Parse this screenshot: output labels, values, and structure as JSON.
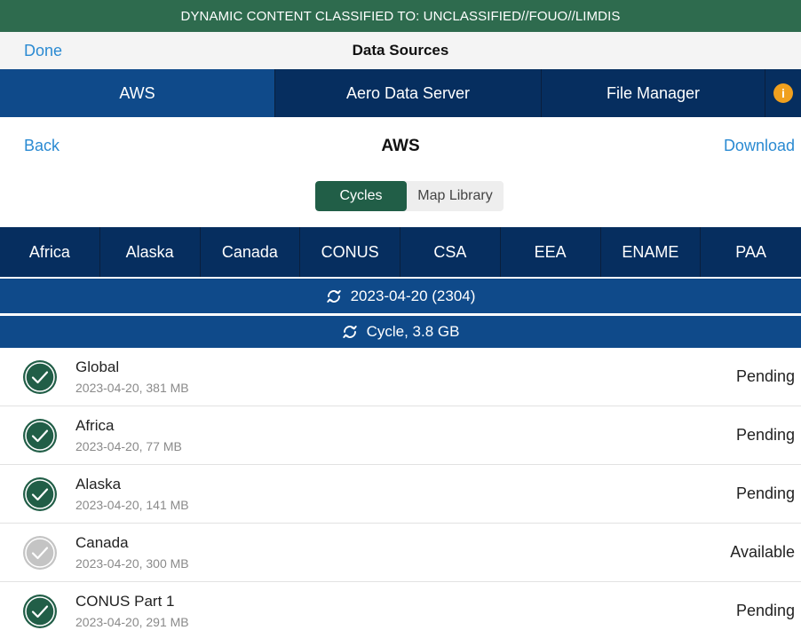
{
  "banner": {
    "text": "DYNAMIC CONTENT CLASSIFIED TO: UNCLASSIFIED//FOUO//LIMDIS"
  },
  "navbar": {
    "done_label": "Done",
    "title": "Data Sources"
  },
  "tabs": [
    {
      "label": "AWS",
      "active": true
    },
    {
      "label": "Aero Data Server",
      "active": false
    },
    {
      "label": "File Manager",
      "active": false
    }
  ],
  "info_icon_glyph": "i",
  "subheader": {
    "back_label": "Back",
    "title": "AWS",
    "download_label": "Download"
  },
  "segments": {
    "cycles_label": "Cycles",
    "map_library_label": "Map Library",
    "selected": "Cycles"
  },
  "regions": [
    "Africa",
    "Alaska",
    "Canada",
    "CONUS",
    "CSA",
    "EEA",
    "ENAME",
    "PAA"
  ],
  "cycle_bar": {
    "label": "2023-04-20 (2304)",
    "icon": "sync-icon"
  },
  "cycle_size_bar": {
    "label": "Cycle, 3.8 GB",
    "icon": "sync-icon"
  },
  "items": [
    {
      "name": "Global",
      "meta": "2023-04-20, 381 MB",
      "status": "Pending",
      "checked": true
    },
    {
      "name": "Africa",
      "meta": "2023-04-20, 77 MB",
      "status": "Pending",
      "checked": true
    },
    {
      "name": "Alaska",
      "meta": "2023-04-20, 141 MB",
      "status": "Pending",
      "checked": true
    },
    {
      "name": "Canada",
      "meta": "2023-04-20, 300 MB",
      "status": "Available",
      "checked": false
    },
    {
      "name": "CONUS Part 1",
      "meta": "2023-04-20, 291 MB",
      "status": "Pending",
      "checked": true
    }
  ],
  "colors": {
    "banner_green": "#2e6b4e",
    "nav_dark_blue": "#062e5f",
    "nav_active_blue": "#0f4a8a",
    "link_blue": "#2a8ad2",
    "check_green": "#215e47",
    "check_grey": "#c4c4c4",
    "info_orange": "#f0a01e"
  }
}
